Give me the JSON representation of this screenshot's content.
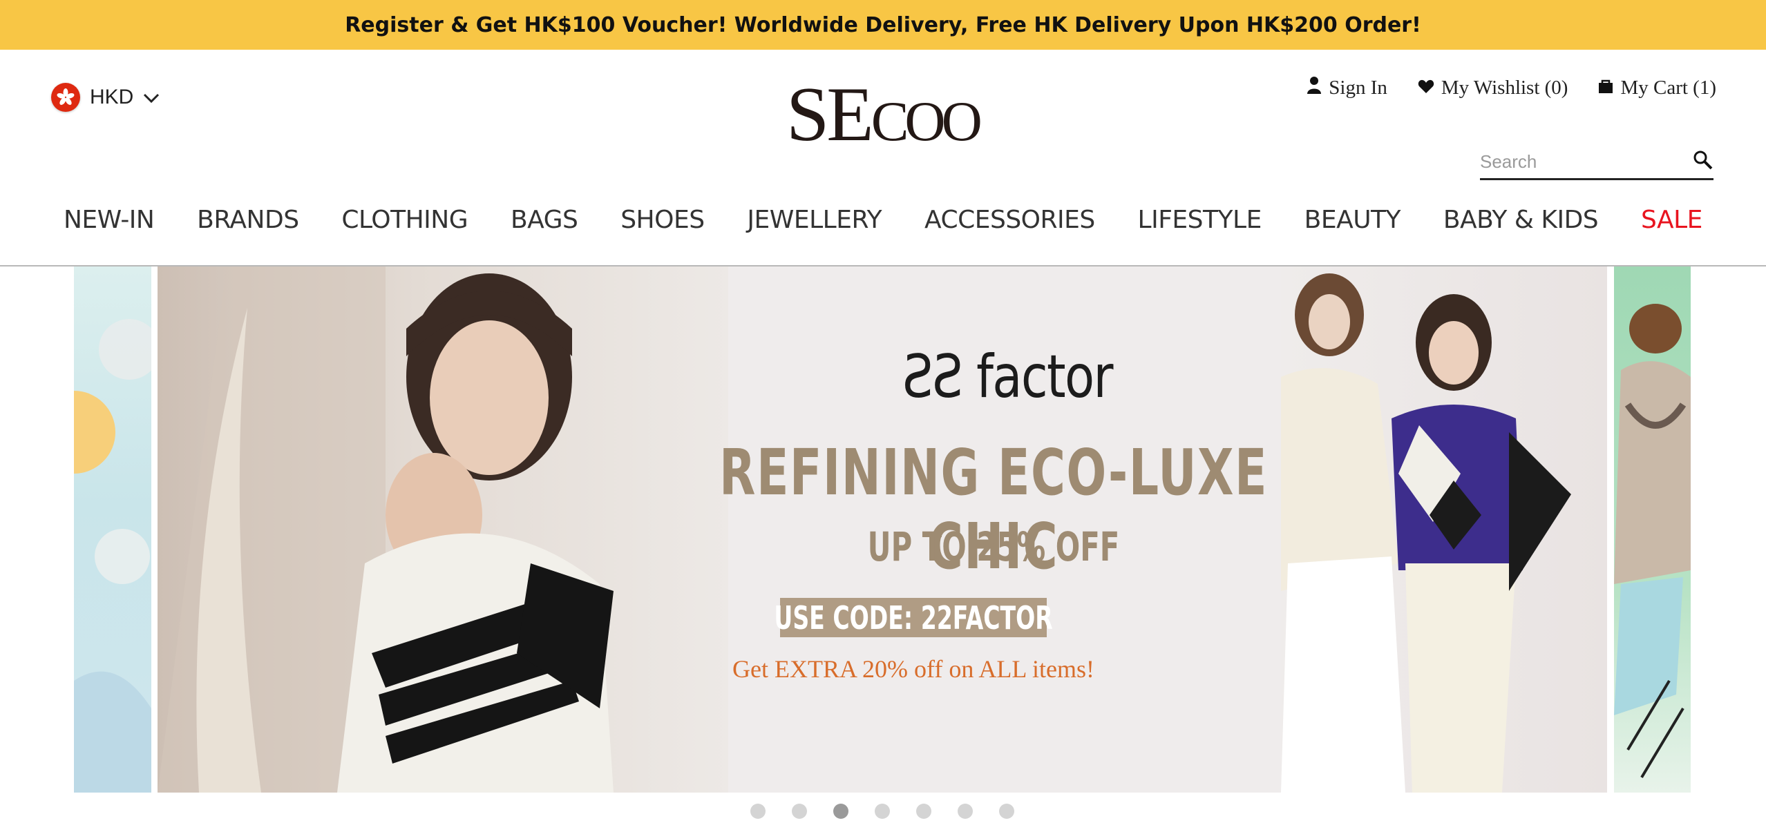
{
  "promo_banner": {
    "text": "Register & Get HK$100 Voucher! Worldwide Delivery, Free HK Delivery Upon HK$200 Order!"
  },
  "header": {
    "currency": {
      "code": "HKD",
      "icon": "hk-flag-icon"
    },
    "logo_text": {
      "first": "SE",
      "second": "COO"
    },
    "account": {
      "sign_in": "Sign In",
      "wishlist": "My Wishlist (0)",
      "cart": "My Cart (1)"
    },
    "search": {
      "placeholder": "Search",
      "value": ""
    }
  },
  "nav": {
    "items": [
      {
        "label": "NEW-IN"
      },
      {
        "label": "BRANDS"
      },
      {
        "label": "CLOTHING"
      },
      {
        "label": "BAGS"
      },
      {
        "label": "SHOES"
      },
      {
        "label": "JEWELLERY"
      },
      {
        "label": "ACCESSORIES"
      },
      {
        "label": "LIFESTYLE"
      },
      {
        "label": "BEAUTY"
      },
      {
        "label": "BABY & KIDS"
      },
      {
        "label": "SALE"
      }
    ]
  },
  "hero": {
    "brand": "ƧƧ factor",
    "headline": "REFINING ECO-LUXE CHIC",
    "subhead": "UP TO 25% OFF",
    "code": "USE CODE: 22FACTOR",
    "extra": "Get EXTRA 20% off on ALL items!"
  },
  "carousel": {
    "slide_count": 7,
    "active_index": 2
  },
  "colors": {
    "promo_bg": "#f8c645",
    "sale": "#e8141f",
    "headline": "#9e8b72",
    "code_badge": "#b09c84",
    "extra_offer": "#d86d2b"
  }
}
